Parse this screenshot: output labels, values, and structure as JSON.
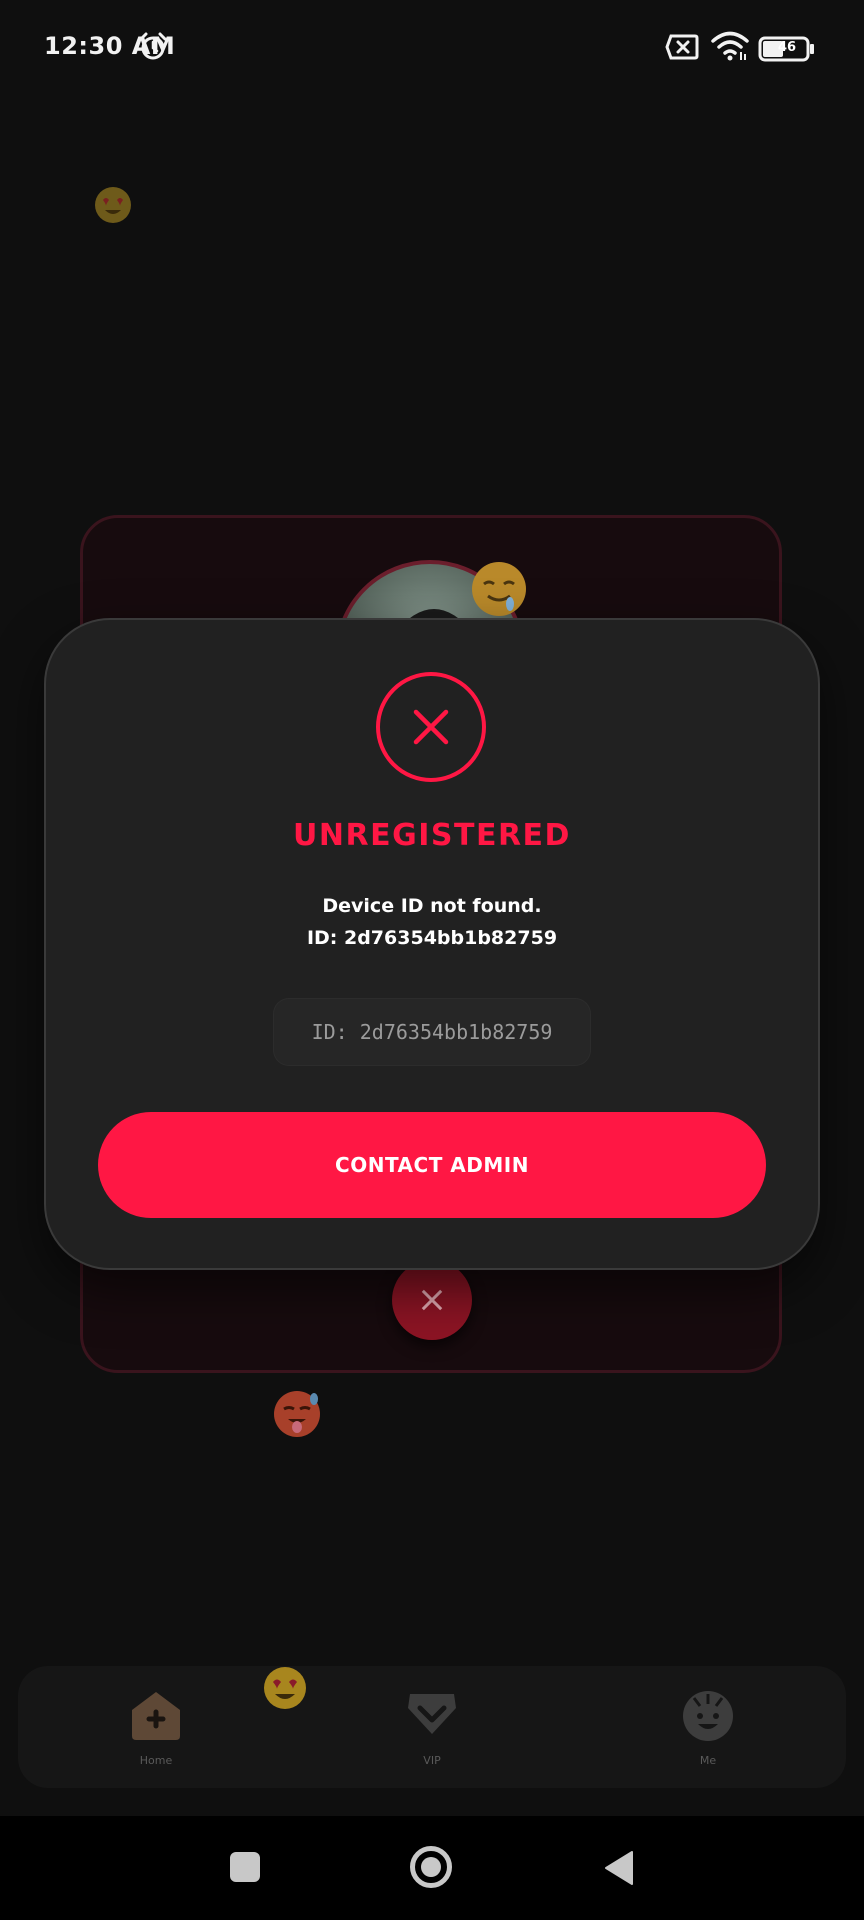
{
  "status_bar": {
    "time": "12:30 AM",
    "battery_level": "46",
    "icons": [
      "alarm-icon",
      "sim-blocked-icon",
      "wifi-icon",
      "battery-icon"
    ]
  },
  "dialog": {
    "title": "UNREGISTERED",
    "message_line1": "Device ID not found.",
    "message_line2": "ID: 2d76354bb1b82759",
    "id_box": "ID: 2d76354bb1b82759",
    "contact_button": "CONTACT ADMIN",
    "icon": "close-circle-icon"
  },
  "bottom_nav": {
    "items": [
      {
        "label": "Home",
        "icon": "home-icon"
      },
      {
        "label": "VIP",
        "icon": "diamond-icon"
      },
      {
        "label": "Me",
        "icon": "face-icon"
      }
    ]
  },
  "system_nav": {
    "icons": [
      "recents-icon",
      "home-circle-icon",
      "back-icon"
    ]
  },
  "colors": {
    "accent": "#ff1744",
    "background": "#0f0f0f",
    "dialog": "#212121"
  }
}
